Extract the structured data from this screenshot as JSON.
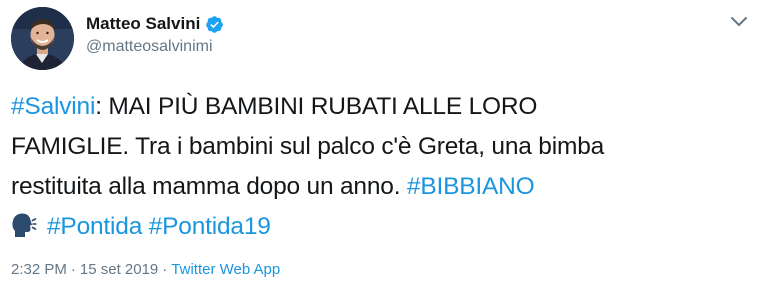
{
  "user": {
    "display_name": "Matteo Salvini",
    "handle": "@matteosalvinimi",
    "verified": true
  },
  "tweet": {
    "line1": {
      "hashtag": "#Salvini",
      "text": ": MAI PIÙ BAMBINI RUBATI ALLE LORO"
    },
    "line2": {
      "text": "FAMIGLIE. Tra i bambini sul palco c'è Greta, una bimba"
    },
    "line3": {
      "text": "restituita alla mamma dopo un anno. ",
      "hashtag": "#BIBBIANO"
    },
    "line4": {
      "emoji_icon": "speaking-head-icon",
      "hashtag1": "#Pontida",
      "hashtag2": "#Pontida19"
    }
  },
  "meta": {
    "time": "2:32 PM",
    "date": "15 set 2019",
    "separator": "·",
    "source": "Twitter Web App"
  },
  "colors": {
    "link": "#1b95e0",
    "secondary": "#657786",
    "text": "#14171a",
    "verified": "#1da1f2"
  }
}
